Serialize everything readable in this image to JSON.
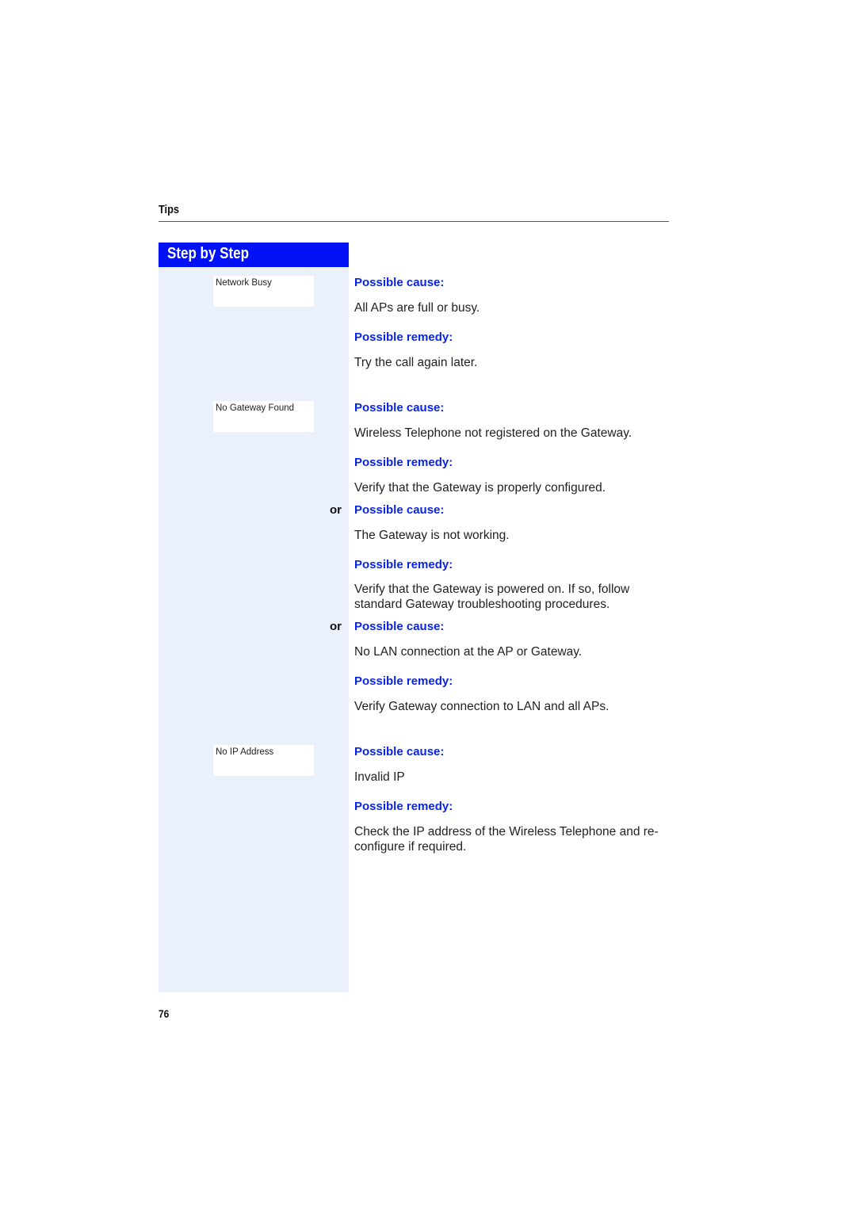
{
  "header": {
    "section": "Tips"
  },
  "sidebar": {
    "title": "Step by Step"
  },
  "displays": [
    {
      "text": "Network Busy"
    },
    {
      "text": "No Gateway Found"
    },
    {
      "text": "No IP Address"
    }
  ],
  "entries": [
    {
      "prefix": "",
      "cause_label": "Possible cause:",
      "cause": "All APs are full or busy.",
      "remedy_label": "Possible remedy:",
      "remedy": "Try the call again later."
    },
    {
      "prefix": "",
      "cause_label": "Possible cause:",
      "cause": "Wireless Telephone not registered on the Gateway.",
      "remedy_label": "Possible remedy:",
      "remedy": "Verify that the Gateway is properly configured."
    },
    {
      "prefix": "or",
      "cause_label": "Possible cause:",
      "cause": "The Gateway is not working.",
      "remedy_label": "Possible remedy:",
      "remedy": "Verify that the Gateway is powered on. If so, follow standard Gateway troubleshooting procedures."
    },
    {
      "prefix": "or",
      "cause_label": "Possible cause:",
      "cause": "No LAN connection at the AP or Gateway.",
      "remedy_label": "Possible remedy:",
      "remedy": "Verify Gateway connection to LAN and all APs."
    },
    {
      "prefix": "",
      "cause_label": "Possible cause:",
      "cause": "Invalid IP",
      "remedy_label": "Possible remedy:",
      "remedy": "Check the IP address of the Wireless Telephone and re-configure if required."
    }
  ],
  "footer": {
    "page_number": "76"
  }
}
